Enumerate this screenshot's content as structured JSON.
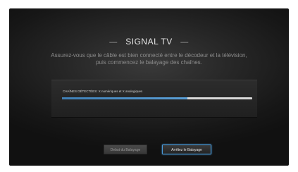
{
  "screen": {
    "title": "SIGNAL TV",
    "title_dash": "—",
    "instruction_line1": "Assurez-vous que le câble est bien connecté entre le décodeur et la télévision,",
    "instruction_line2": "puis commencez le balayage des chaînes."
  },
  "scan": {
    "channels_detected_label": "CHAÎNES DÉTECTÉES: X numériques et X analogiques",
    "progress_fraction": 0.66,
    "progress_color": "#4a8ec8"
  },
  "buttons": {
    "start_label": "Debut du Balayage",
    "stop_label": "Arrêtez le Balayage",
    "focus_color": "#4a9ad8"
  }
}
